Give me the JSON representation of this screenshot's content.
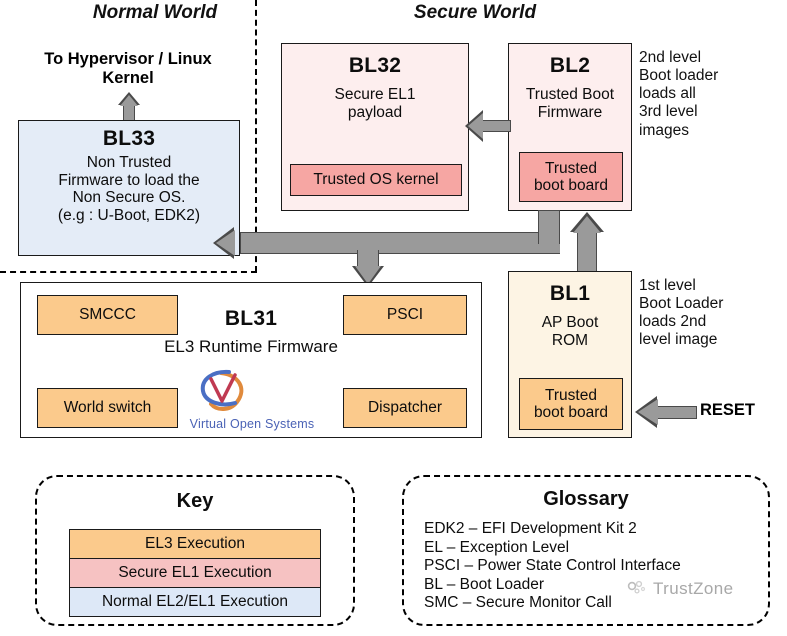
{
  "worlds": {
    "normal": "Normal World",
    "secure": "Secure World"
  },
  "divider": {
    "style": "dashed"
  },
  "top_label": "To Hypervisor / Linux\nKernel",
  "top_label_line1": "To Hypervisor / Linux",
  "top_label_line2": "Kernel",
  "boxes": {
    "bl33": {
      "title": "BL33",
      "lines": [
        "Non Trusted",
        "Firmware to load the",
        "Non Secure OS.",
        "(e.g : U-Boot, EDK2)"
      ],
      "color": "#e4ecf7"
    },
    "bl32": {
      "title": "BL32",
      "lines": [
        "Secure EL1",
        "payload"
      ],
      "inner_label": "Trusted OS kernel",
      "color": "#fdeeee",
      "inner_color": "#f6a6a3"
    },
    "bl2": {
      "title": "BL2",
      "lines": [
        "Trusted Boot",
        "Firmware"
      ],
      "inner_label": "Trusted\nboot board",
      "inner_line1": "Trusted",
      "inner_line2": "boot board",
      "color": "#fdeeee",
      "inner_color": "#f6a6a3",
      "note": [
        "2nd level",
        "Boot loader",
        "loads all",
        "3rd level",
        "images"
      ]
    },
    "bl1": {
      "title": "BL1",
      "lines": [
        "AP Boot",
        "ROM"
      ],
      "inner_line1": "Trusted",
      "inner_line2": "boot board",
      "color": "#fdf4e4",
      "inner_color": "#fbca8c",
      "note": [
        "1st level",
        "Boot Loader",
        "loads 2nd",
        "level image"
      ]
    },
    "bl31": {
      "title": "BL31",
      "subtitle": "EL3 Runtime Firmware",
      "color": "#ffffff",
      "blocks": [
        {
          "label": "SMCCC",
          "color": "#fbca8c"
        },
        {
          "label": "PSCI",
          "color": "#fbca8c"
        },
        {
          "label": "World switch",
          "color": "#fbca8c"
        },
        {
          "label": "Dispatcher",
          "color": "#fbca8c"
        }
      ],
      "logo_text": "Virtual Open Systems"
    }
  },
  "reset": {
    "label": "RESET"
  },
  "key": {
    "title": "Key",
    "rows": [
      {
        "label": "EL3 Execution",
        "color": "#fbca8c"
      },
      {
        "label": "Secure EL1 Execution",
        "color": "#f6c2c2"
      },
      {
        "label": "Normal EL2/EL1 Execution",
        "color": "#dde8f7"
      }
    ]
  },
  "glossary": {
    "title": "Glossary",
    "entries": [
      "EDK2 – EFI Development Kit 2",
      "EL – Exception Level",
      "PSCI – Power State Control Interface",
      "BL – Boot Loader",
      "SMC – Secure Monitor Call"
    ]
  },
  "watermark": {
    "label": "TrustZone"
  }
}
